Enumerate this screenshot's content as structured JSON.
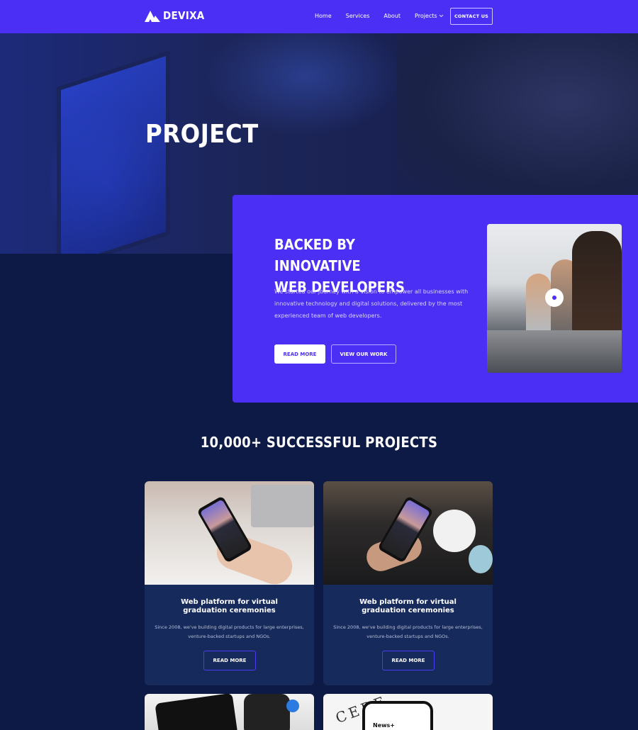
{
  "nav": {
    "brand": "DEVIXA",
    "links": [
      "Home",
      "Services",
      "About",
      "Projects"
    ],
    "contact_label": "CONTACT US"
  },
  "hero": {
    "title": "PROJECT"
  },
  "feature": {
    "title_line1": "BACKED BY INNOVATIVE",
    "title_line2": "WEB DEVELOPERS",
    "text": "We started our journey with a vision to empower all businesses with innovative technology and digital solutions, delivered by the most experienced team of web developers.",
    "primary_button": "READ MORE",
    "secondary_button": "VIEW OUR WORK"
  },
  "projects": {
    "heading": "10,000+ SUCCESSFUL PROJECTS",
    "cards": [
      {
        "title": "Web platform for virtual graduation ceremonies",
        "text": "Since 2008, we've building digital products for large enterprises, venture-backed startups and NGOs.",
        "button": "READ MORE"
      },
      {
        "title": "Web platform for virtual graduation ceremonies",
        "text": "Since 2008, we've building digital products for large enterprises, venture-backed startups and NGOs.",
        "button": "READ MORE"
      }
    ],
    "partial_card_text": [
      "CERE",
      "News+"
    ]
  },
  "colors": {
    "brand": "#4c2ff5",
    "background": "#0c1a45",
    "card": "#172a5c"
  },
  "icons": [
    "logo-mountain-icon",
    "chevron-down-icon",
    "play-icon"
  ]
}
